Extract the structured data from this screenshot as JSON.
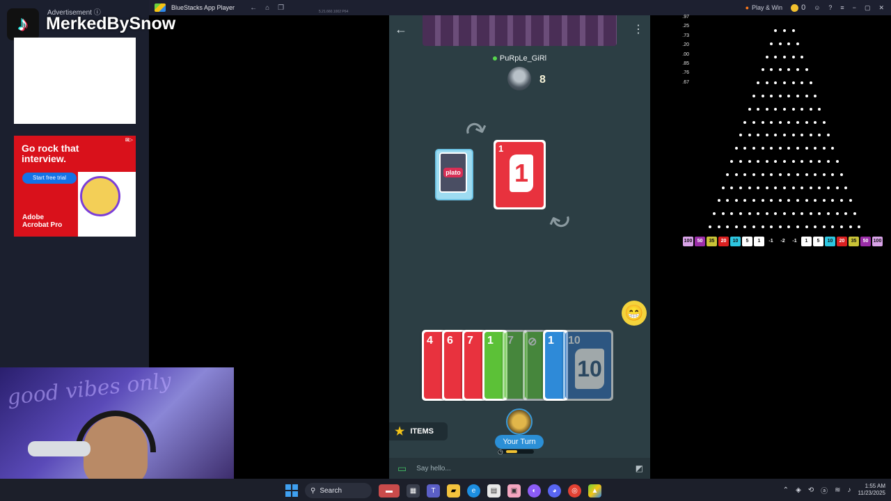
{
  "titlebar": {
    "app_title": "BlueStacks App Player",
    "subtitle": "5.21.660.1002  P64",
    "play_win": "Play & Win",
    "coins": "0"
  },
  "left_panel": {
    "ad_label": "Advertisement ⓘ",
    "channel_name": "MerkedBySnow",
    "adobe_ad": {
      "headline": "Go rock that interview.",
      "cta": "Start free trial",
      "brand": "Adobe Acrobat Pro"
    }
  },
  "webcam": {
    "neon_text": "good vibes only"
  },
  "game": {
    "opponent": {
      "name": "PuRpLe_GiRl",
      "card_count": "8"
    },
    "deck_logo": "plato",
    "discard": {
      "value": "1",
      "color": "#e8323e"
    },
    "hand": [
      {
        "value": "4",
        "color": "#e8323e",
        "playable": false
      },
      {
        "value": "6",
        "color": "#e8323e",
        "playable": false
      },
      {
        "value": "7",
        "color": "#e8323e",
        "playable": false
      },
      {
        "value": "1",
        "color": "#5cc137",
        "playable": true
      },
      {
        "value": "7",
        "color": "#5cc137",
        "playable": false
      },
      {
        "value": "⊘",
        "color": "#5cc137",
        "playable": false
      },
      {
        "value": "1",
        "color": "#2e8ad8",
        "playable": true
      },
      {
        "value": "10",
        "color": "#2e6bb3",
        "playable": false
      }
    ],
    "items_label": "ITEMS",
    "turn_label": "Your Turn",
    "timer_fraction": 0.4,
    "chat_placeholder": "Say hello..."
  },
  "plinko": {
    "odds": [
      ".97",
      ".25",
      ".73",
      ".20",
      ".00",
      ".85",
      ".76",
      ".67"
    ],
    "multipliers": [
      {
        "label": "100",
        "color": "#d9a3e8"
      },
      {
        "label": "50",
        "color": "#9b2ea8"
      },
      {
        "label": "35",
        "color": "#c9c337"
      },
      {
        "label": "20",
        "color": "#d92020"
      },
      {
        "label": "10",
        "color": "#2ec6e0"
      },
      {
        "label": "5",
        "color": "#ffffff"
      },
      {
        "label": "1",
        "color": "#ffffff"
      },
      {
        "label": "-1",
        "color": ""
      },
      {
        "label": "-2",
        "color": ""
      },
      {
        "label": "-1",
        "color": ""
      },
      {
        "label": "1",
        "color": "#ffffff"
      },
      {
        "label": "5",
        "color": "#ffffff"
      },
      {
        "label": "10",
        "color": "#2ec6e0"
      },
      {
        "label": "20",
        "color": "#d92020"
      },
      {
        "label": "35",
        "color": "#c9c337"
      },
      {
        "label": "50",
        "color": "#9b2ea8"
      },
      {
        "label": "100",
        "color": "#d9a3e8"
      }
    ]
  },
  "taskbar": {
    "search_label": "Search",
    "time": "1:55 AM",
    "date": "11/23/2025"
  }
}
